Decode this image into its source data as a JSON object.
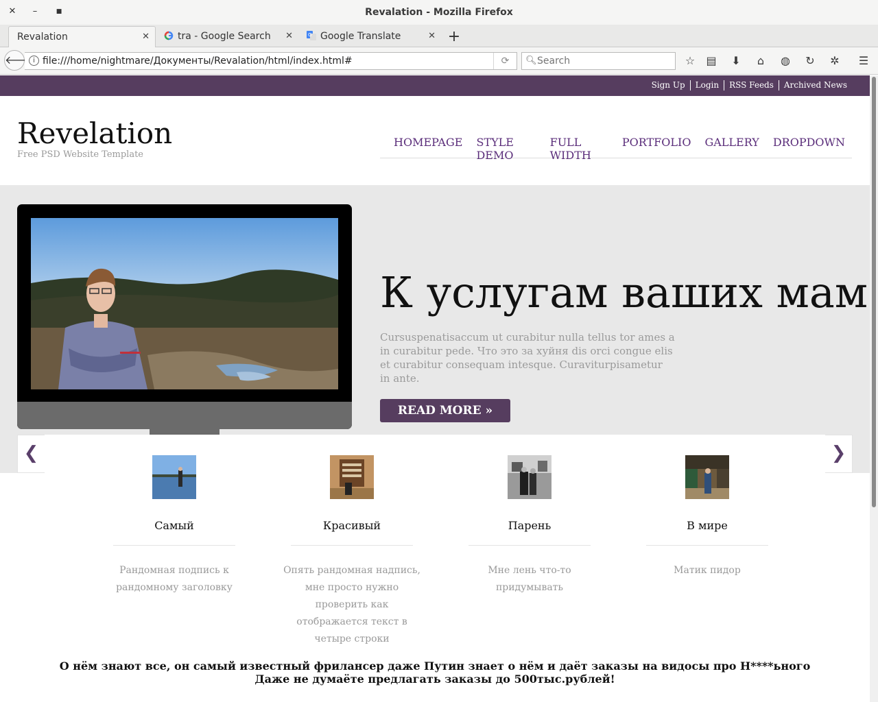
{
  "window": {
    "title": "Revalation - Mozilla Firefox"
  },
  "tabs": [
    {
      "label": "Revalation",
      "icon": "none",
      "active": true
    },
    {
      "label": "tra - Google Search",
      "icon": "google-icon"
    },
    {
      "label": "Google Translate",
      "icon": "google-translate-icon"
    }
  ],
  "navbar": {
    "url": "file:///home/nightmare/Документы/Revalation/html/index.html#",
    "search_placeholder": "Search"
  },
  "site": {
    "top_links": [
      "Sign Up",
      "Login",
      "RSS Feeds",
      "Archived News"
    ],
    "brand": "Revelation",
    "tagline": "Free PSD Website Template",
    "nav": [
      "HOMEPAGE",
      "STYLE DEMO",
      "FULL WIDTH",
      "PORTFOLIO",
      "GALLERY",
      "DROPDOWN"
    ],
    "accent_color": "#563d5f",
    "nav_color": "#5a2d7a"
  },
  "hero": {
    "title": "К услугам ваших мам",
    "text": "Cursuspenatisaccum ut curabitur nulla tellus tor ames a in curabitur pede. Что это за хуйня dis orci congue elis et curabitur consequam intesque. Curaviturpisametur in ante.",
    "button": "READ MORE »"
  },
  "cards": [
    {
      "title": "Самый",
      "desc": "Рандомная подпись к рандомному заголовку"
    },
    {
      "title": "Красивый",
      "desc": "Опять рандомная надпись, мне просто нужно проверить как отображается текст в четыре строки"
    },
    {
      "title": "Парень",
      "desc": "Мне лень что-то придумывать"
    },
    {
      "title": "В мире",
      "desc": "Матик пидор"
    }
  ],
  "footer": {
    "line1": "О нём знают все, он самый известный фрилансер даже Путин знает о нём и даёт заказы на видосы про Н****ьного",
    "line2": "Даже не думаёте предлагать заказы до 500тыс.рублей!"
  }
}
